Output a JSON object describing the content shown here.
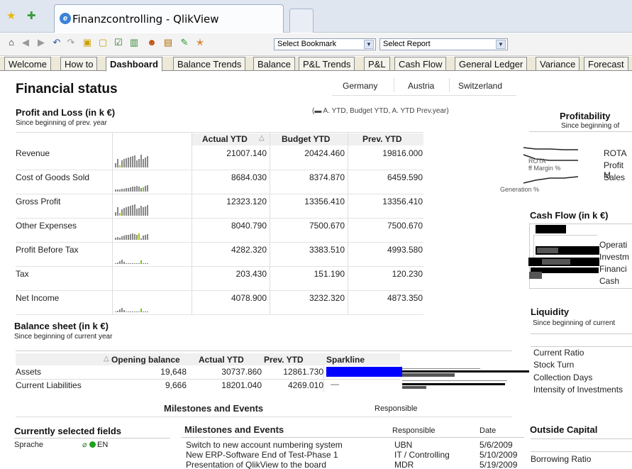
{
  "browser": {
    "tab_title": "Finanzcontrolling - QlikView"
  },
  "toolbar": {
    "bookmark_select": "Select Bookmark",
    "report_select": "Select Report"
  },
  "sheet_tabs": [
    "Welcome",
    "How to",
    "Dashboard",
    "Balance Trends",
    "Balance",
    "P&L Trends",
    "P&L",
    "Cash Flow",
    "General Ledger",
    "Variance",
    "Forecast"
  ],
  "active_tab": "Dashboard",
  "page_title": "Financial status",
  "countries": [
    "Germany",
    "Austria",
    "Switzerland"
  ],
  "pl": {
    "title": "Profit and Loss (in k €)",
    "subtitle": "Since beginning of prev. year",
    "legend": "(▬ A. YTD,  Budget YTD,  A. YTD Prev.year)",
    "columns": [
      "Actual YTD",
      "Budget YTD",
      "Prev. YTD"
    ],
    "sort_icon": "△",
    "rows": [
      {
        "label": "Revenue",
        "actual": "21007.140",
        "budget": "20424.460",
        "prev": "19816.000"
      },
      {
        "label": "Cost of Goods Sold",
        "actual": "8684.030",
        "budget": "8374.870",
        "prev": "6459.590"
      },
      {
        "label": "Gross Profit",
        "actual": "12323.120",
        "budget": "13356.410",
        "prev": "13356.410"
      },
      {
        "label": "Other Expenses",
        "actual": "8040.790",
        "budget": "7500.670",
        "prev": "7500.670"
      },
      {
        "label": "Profit Before Tax",
        "actual": "4282.320",
        "budget": "3383.510",
        "prev": "4993.580"
      },
      {
        "label": "Tax",
        "actual": "203.430",
        "budget": "151.190",
        "prev": "120.230"
      },
      {
        "label": "Net Income",
        "actual": "4078.900",
        "budget": "3232.320",
        "prev": "4873.350"
      }
    ]
  },
  "profitability": {
    "title": "Profitability",
    "subtitle": "Since beginning of",
    "labels": [
      "ROTA",
      "ff Margin %",
      "Generation %"
    ],
    "right_labels": [
      "ROTA",
      "Profit M",
      "Sales"
    ]
  },
  "cashflow": {
    "title": "Cash Flow (in k €)",
    "labels": [
      "Operati",
      "Investm",
      "Financi",
      "Cash"
    ]
  },
  "liquidity": {
    "title": "Liquidity",
    "subtitle": "Since beginning of current",
    "rows": [
      "Current Ratio",
      "Stock Turn",
      "Collection Days",
      "Intensity of Investments"
    ]
  },
  "balance": {
    "title": "Balance sheet (in k €)",
    "subtitle": "Since beginning of current year",
    "columns": [
      "Opening balance",
      "Actual YTD",
      "Prev. YTD",
      "Sparkline"
    ],
    "sort_icon": "△",
    "rows": [
      {
        "label": "Assets",
        "opening": "19,648",
        "actual": "30737.860",
        "prev": "12861.730"
      },
      {
        "label": "Current Liabilities",
        "opening": "9,666",
        "actual": "18201.040",
        "prev": "4269.010",
        "spark": "—"
      }
    ],
    "spark_color": "#0000ff"
  },
  "milestones_header": {
    "title": "Milestones and Events",
    "responsible": "Responsible"
  },
  "selected_fields": {
    "title": "Currently selected fields",
    "field": "Sprache",
    "value": "EN"
  },
  "milestones": {
    "title": "Milestones and Events",
    "col_responsible": "Responsible",
    "col_date": "Date",
    "rows": [
      {
        "event": "Switch to new account numbering system",
        "responsible": "UBN",
        "date": "5/6/2009"
      },
      {
        "event": "New ERP-Software End of Test-Phase 1",
        "responsible": "IT / Controlling",
        "date": "5/10/2009"
      },
      {
        "event": "Presentation of QlikView to the board",
        "responsible": "MDR",
        "date": "5/19/2009"
      }
    ]
  },
  "outside_capital": {
    "title": "Outside Capital",
    "rows": [
      "Borrowing Ratio"
    ]
  }
}
